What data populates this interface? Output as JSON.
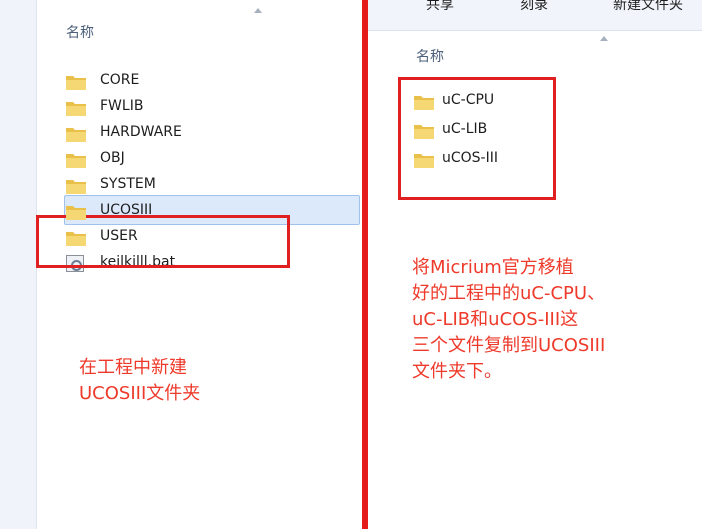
{
  "left_pane": {
    "column_header": "名称",
    "items": [
      {
        "label": "CORE"
      },
      {
        "label": "FWLIB"
      },
      {
        "label": "HARDWARE"
      },
      {
        "label": "OBJ"
      },
      {
        "label": "SYSTEM"
      },
      {
        "label": "UCOSIII"
      },
      {
        "label": "USER"
      },
      {
        "label": "keilkilll.bat"
      }
    ],
    "selected_item": "UCOSIII",
    "annotation": [
      "在工程中新建",
      "UCOSIII文件夹"
    ]
  },
  "right_pane": {
    "toolbar": [
      "共享",
      "刻录",
      "新建文件夹"
    ],
    "column_header": "名称",
    "items": [
      {
        "label": "uC-CPU"
      },
      {
        "label": "uC-LIB"
      },
      {
        "label": "uCOS-III"
      }
    ],
    "annotation": [
      "将Micrium官方移植",
      "好的工程中的uC-CPU、",
      "uC-LIB和uCOS-III这",
      "三个文件复制到UCOSIII",
      "文件夹下。"
    ]
  },
  "colors": {
    "annotation_red": "#e02020",
    "note_red": "#ee3a2a",
    "folder_yellow": "#e8c04a",
    "selection_blue": "#dbe9fb"
  }
}
